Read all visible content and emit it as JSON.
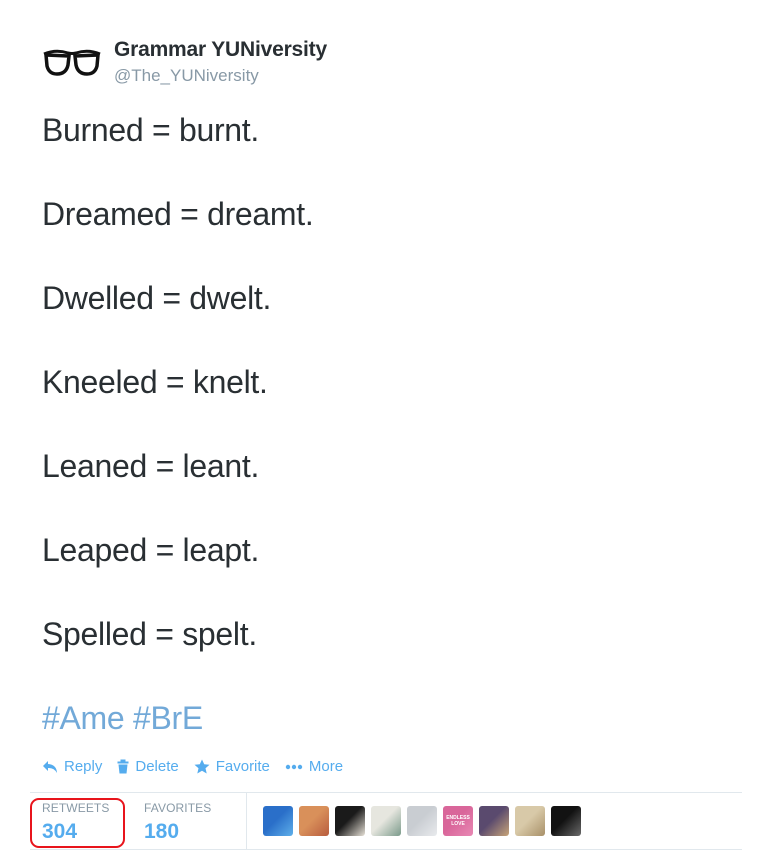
{
  "user": {
    "display_name": "Grammar YUNiversity",
    "username": "@The_YUNiversity",
    "avatar_icon": "glasses-icon"
  },
  "tweet": {
    "lines": [
      "Burned = burnt.",
      "Dreamed = dreamt.",
      "Dwelled = dwelt.",
      "Kneeled = knelt.",
      "Leaned = leant.",
      "Leaped = leapt.",
      "Spelled = spelt."
    ],
    "hashtags": [
      "#Ame",
      "#BrE"
    ]
  },
  "actions": {
    "reply": "Reply",
    "delete": "Delete",
    "favorite": "Favorite",
    "more": "More"
  },
  "stats": {
    "retweets_label": "RETWEETS",
    "retweets_count": "304",
    "favorites_label": "FAVORITES",
    "favorites_count": "180"
  },
  "favoriters": [
    {
      "name": "favoriter-avatar-1",
      "colors": [
        "#2a6fc9",
        "#5fb0ea"
      ],
      "text": ""
    },
    {
      "name": "favoriter-avatar-2",
      "colors": [
        "#d9905a",
        "#b85c3e"
      ],
      "text": ""
    },
    {
      "name": "favoriter-avatar-3",
      "colors": [
        "#1a1a1a",
        "#e8e2d8"
      ],
      "text": ""
    },
    {
      "name": "favoriter-avatar-4",
      "colors": [
        "#e6e6df",
        "#7a9a8a"
      ],
      "text": ""
    },
    {
      "name": "favoriter-avatar-5",
      "colors": [
        "#c9cdd2",
        "#e8eaed"
      ],
      "text": ""
    },
    {
      "name": "favoriter-avatar-6",
      "colors": [
        "#d9669a",
        "#e888b4"
      ],
      "text": "ENDLESS LOVE"
    },
    {
      "name": "favoriter-avatar-7",
      "colors": [
        "#5a4a6e",
        "#c8a478"
      ],
      "text": ""
    },
    {
      "name": "favoriter-avatar-8",
      "colors": [
        "#d8c9a8",
        "#a89068"
      ],
      "text": ""
    },
    {
      "name": "favoriter-avatar-9",
      "colors": [
        "#121212",
        "#6a6a6a"
      ],
      "text": ""
    }
  ],
  "colors": {
    "link": "#55acee",
    "highlight": "#e8141c",
    "text": "#292f33",
    "muted": "#8899a6"
  }
}
